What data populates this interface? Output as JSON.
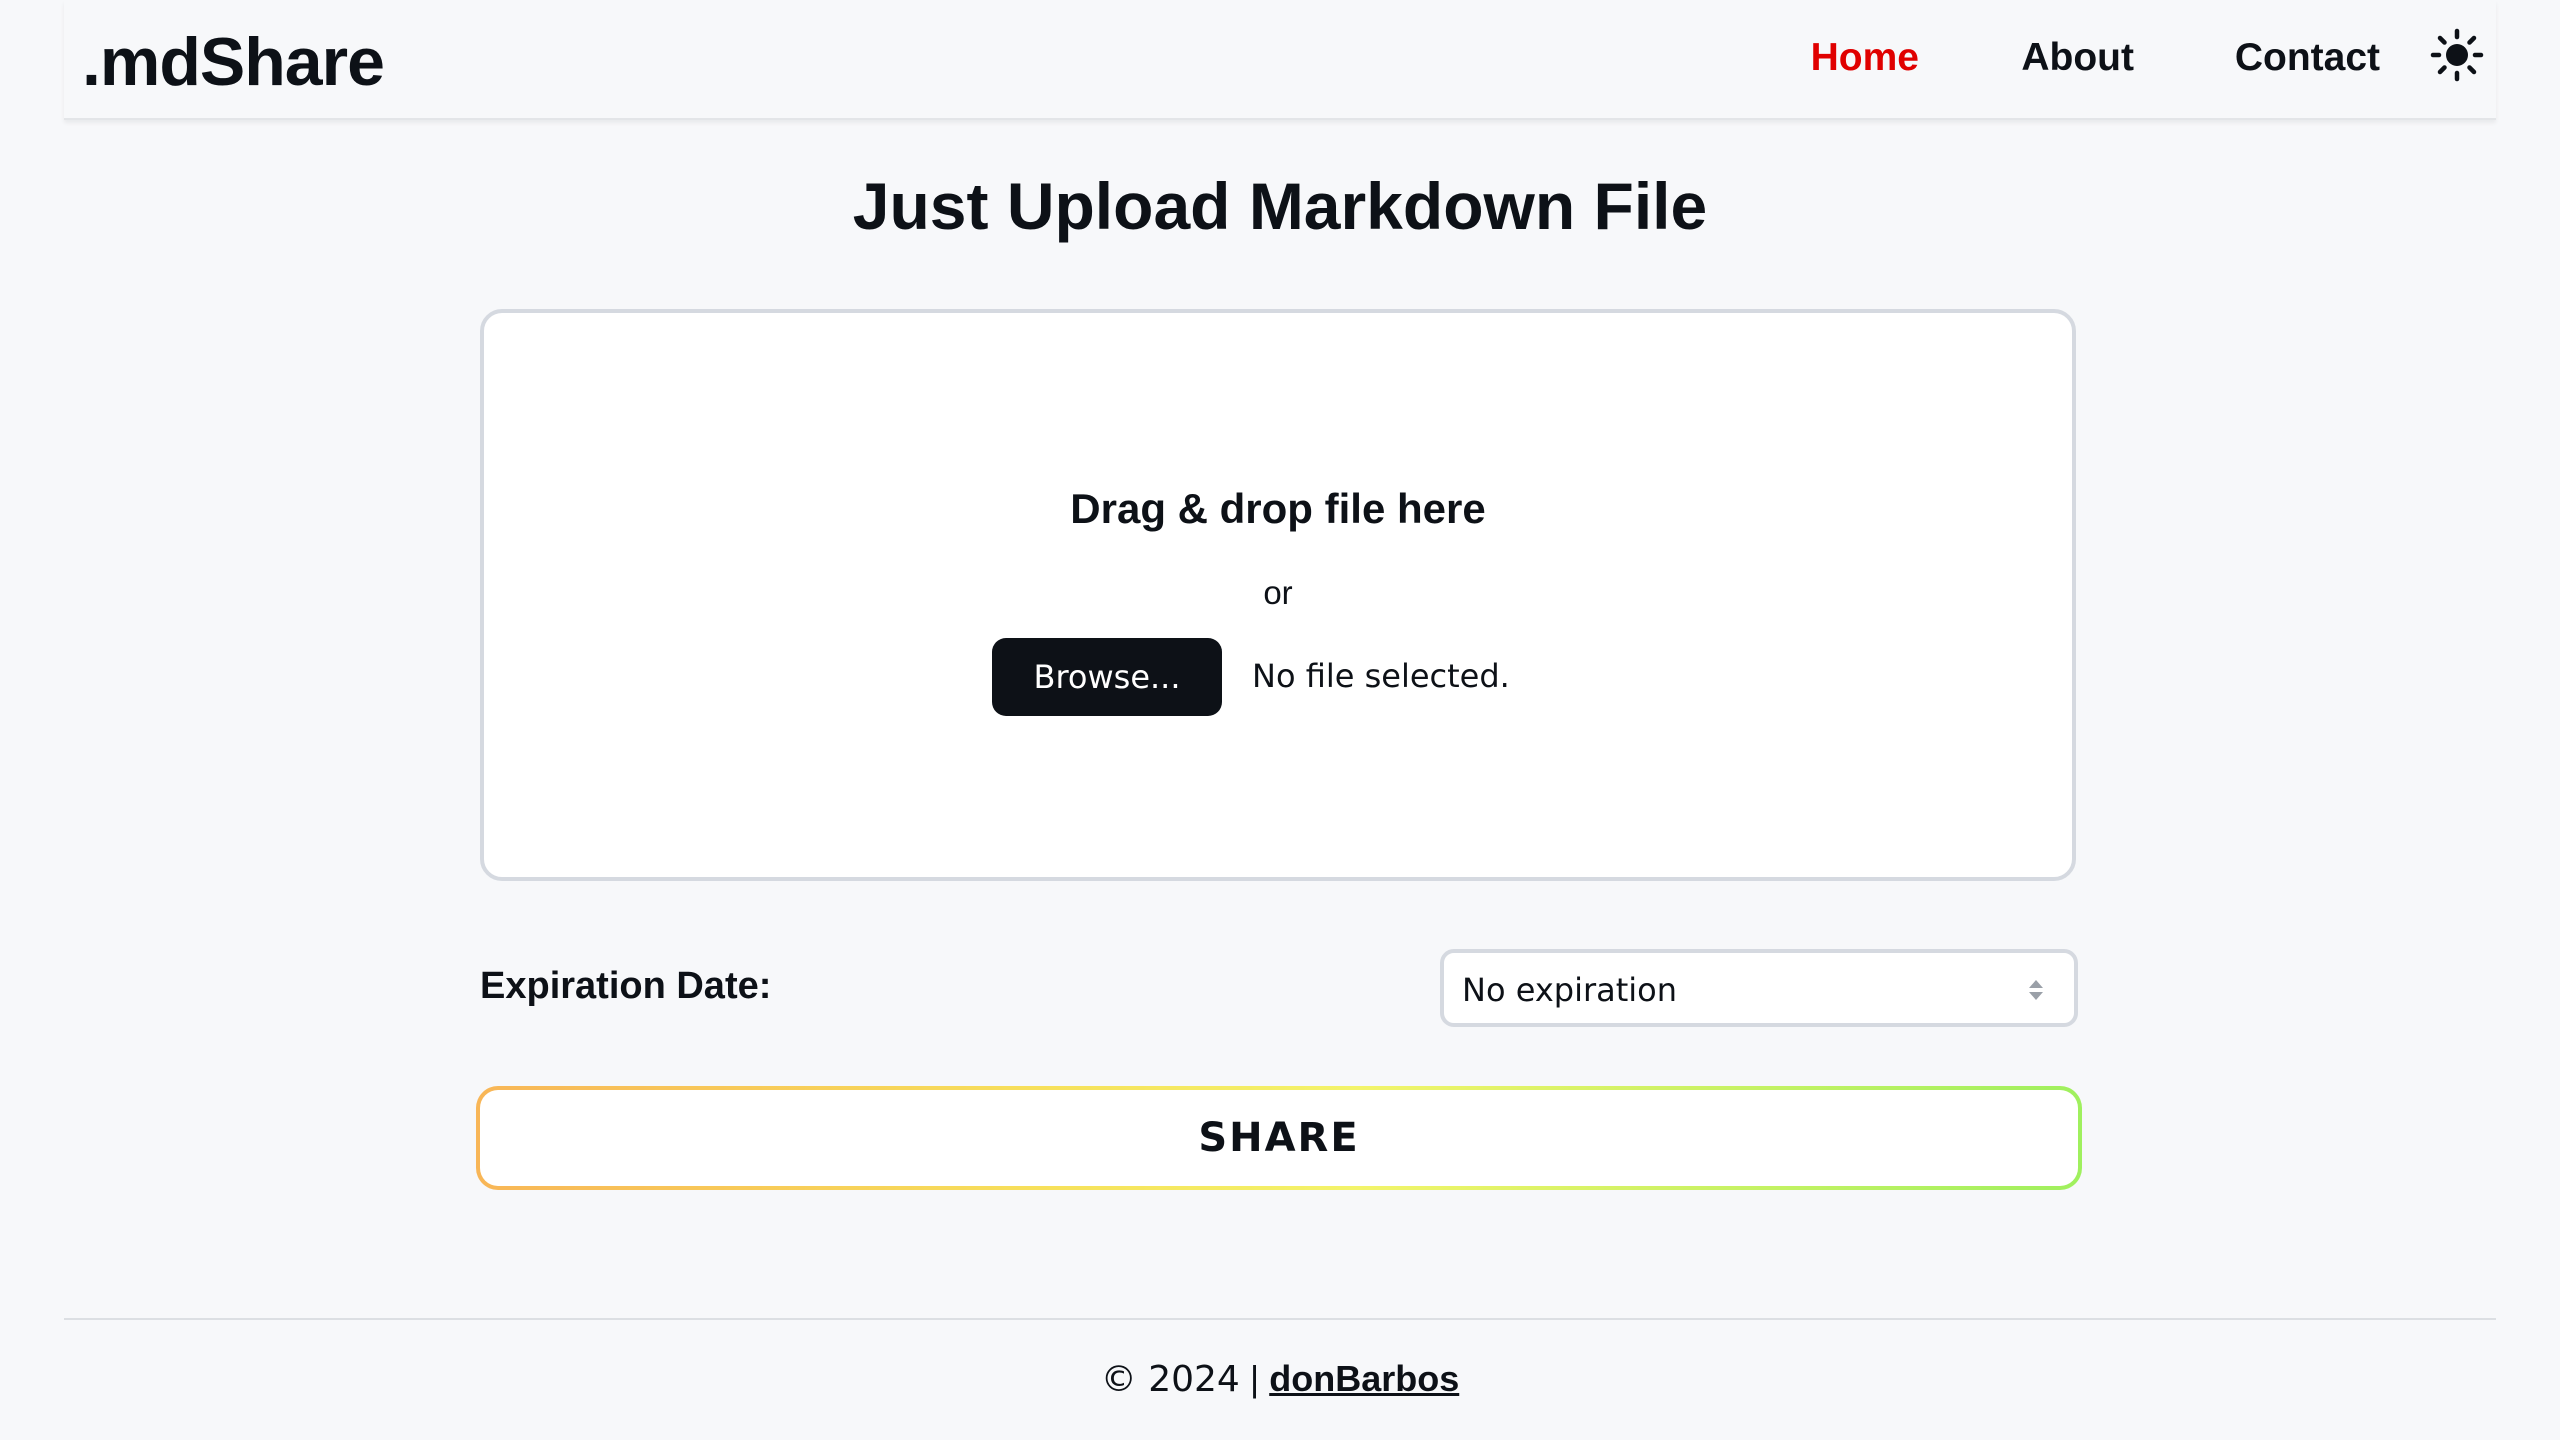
{
  "header": {
    "logo": ".mdShare",
    "nav": {
      "home": "Home",
      "about": "About",
      "contact": "Contact"
    },
    "theme_icon": "sun-icon",
    "active_color": "#e00000"
  },
  "main": {
    "title": "Just Upload Markdown File",
    "dropzone": {
      "title": "Drag & drop file here",
      "or": "or",
      "browse_label": "Browse...",
      "file_status": "No file selected."
    },
    "expiration": {
      "label": "Expiration Date:",
      "selected": "No expiration"
    },
    "share_label": "SHARE"
  },
  "footer": {
    "copyright": "© 2024",
    "separator": "|",
    "author": "donBarbos"
  }
}
